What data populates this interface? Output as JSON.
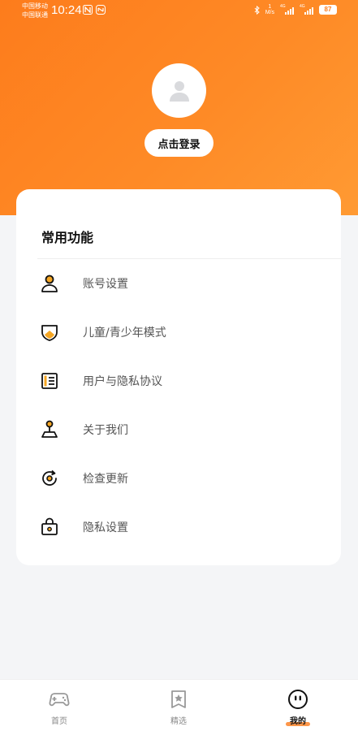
{
  "status_bar": {
    "carrier_1": "中国移动",
    "carrier_2": "中国联通",
    "time": "10:24",
    "net_speed_value": "1",
    "net_speed_unit": "M/s",
    "signal_1_label": "4G",
    "signal_2_label": "4G",
    "battery": "87"
  },
  "profile": {
    "login_label": "点击登录"
  },
  "section": {
    "title": "常用功能",
    "items": [
      {
        "label": "账号设置",
        "icon": "user-icon"
      },
      {
        "label": "儿童/青少年模式",
        "icon": "shield-icon"
      },
      {
        "label": "用户与隐私协议",
        "icon": "document-icon"
      },
      {
        "label": "关于我们",
        "icon": "pin-icon"
      },
      {
        "label": "检查更新",
        "icon": "refresh-icon"
      },
      {
        "label": "隐私设置",
        "icon": "lock-icon"
      }
    ]
  },
  "tabbar": {
    "tabs": [
      {
        "label": "首页",
        "icon": "gamepad-icon",
        "active": false
      },
      {
        "label": "精选",
        "icon": "star-bookmark-icon",
        "active": false
      },
      {
        "label": "我的",
        "icon": "face-icon",
        "active": true
      }
    ]
  },
  "colors": {
    "accent": "#fd7c1c",
    "icon_highlight": "#f5a623"
  }
}
